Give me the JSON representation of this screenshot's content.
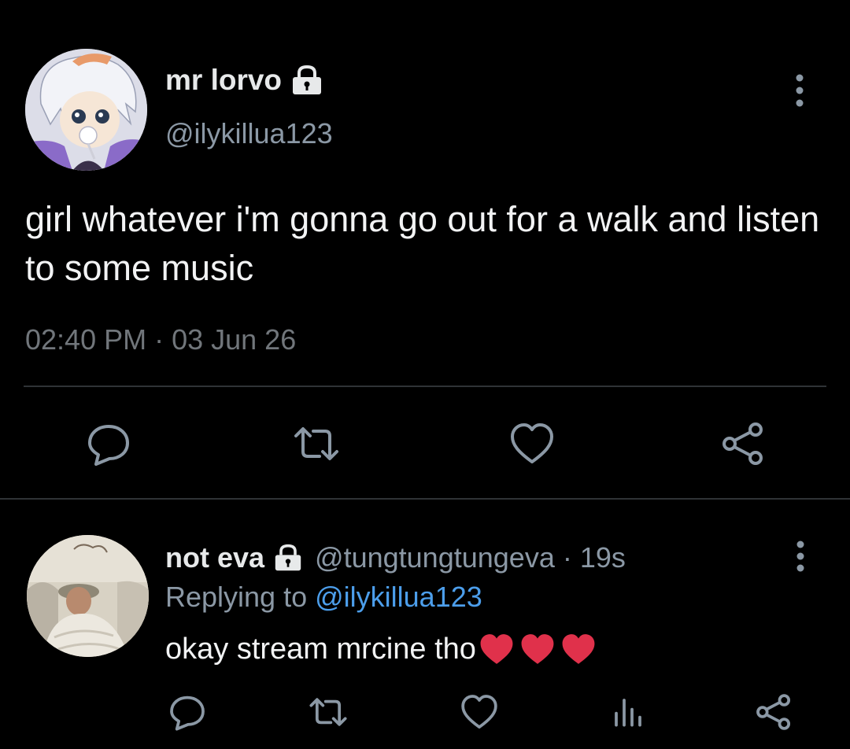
{
  "tweet": {
    "display_name": "mr lorvo",
    "handle": "@ilykillua123",
    "text": "girl whatever i'm gonna go out for a walk and listen to some music",
    "timestamp": "02:40 PM · 03 Jun 26",
    "avatar_icon": "anime-character-avatar",
    "lock_icon": "lock-icon",
    "more_icon": "more-vertical-icon",
    "actions": [
      {
        "icon": "reply-icon"
      },
      {
        "icon": "retweet-icon"
      },
      {
        "icon": "like-icon"
      },
      {
        "icon": "share-icon"
      }
    ]
  },
  "reply": {
    "display_name": "not eva",
    "handle": "@tungtungtungeva",
    "separator": "·",
    "time_ago": "19s",
    "replying_prefix": "Replying to",
    "replying_handle": "@ilykillua123",
    "text": "okay stream mrcine tho",
    "emoji": [
      "❤️",
      "❤️",
      "❤️"
    ],
    "avatar_icon": "person-photo-avatar",
    "actions": [
      {
        "icon": "reply-icon"
      },
      {
        "icon": "retweet-icon"
      },
      {
        "icon": "like-icon"
      },
      {
        "icon": "analytics-icon"
      },
      {
        "icon": "share-icon"
      }
    ]
  },
  "colors": {
    "background": "#000000",
    "text": "#e7e9ea",
    "secondary": "#8b98a5",
    "link": "#4c9eeb",
    "divider": "#2f3336",
    "heart": "#e0314b"
  }
}
